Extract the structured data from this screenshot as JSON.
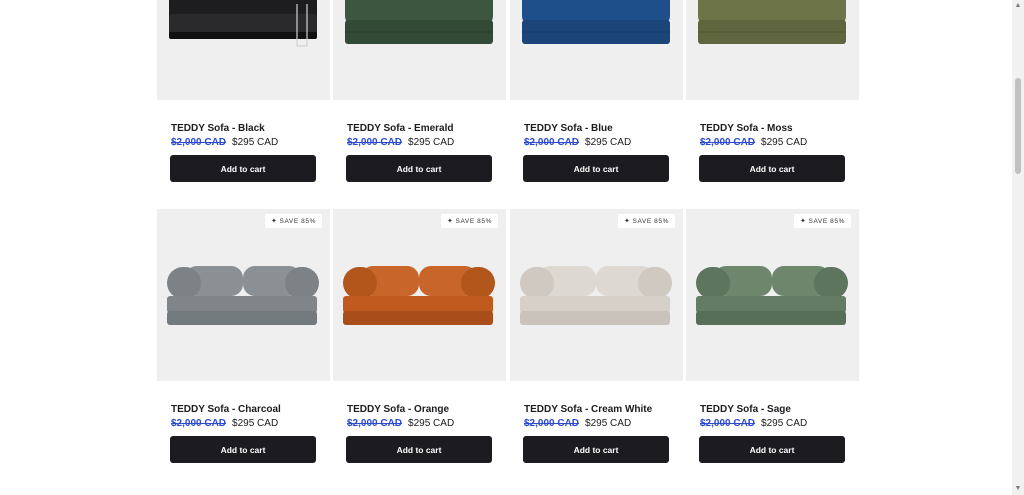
{
  "products": [
    {
      "title": "TEDDY Sofa - Black",
      "old_price": "$2,000 CAD",
      "price": "$295 CAD",
      "button": "Add to cart",
      "color": "#1d1d1f"
    },
    {
      "title": "TEDDY Sofa - Emerald",
      "old_price": "$2,000 CAD",
      "price": "$295 CAD",
      "button": "Add to cart",
      "color": "#3d5640"
    },
    {
      "title": "TEDDY Sofa - Blue",
      "old_price": "$2,000 CAD",
      "price": "$295 CAD",
      "button": "Add to cart",
      "color": "#1f4f8a"
    },
    {
      "title": "TEDDY Sofa - Moss",
      "old_price": "$2,000 CAD",
      "price": "$295 CAD",
      "button": "Add to cart",
      "color": "#6d7448"
    },
    {
      "title": "TEDDY Sofa - Charcoal",
      "old_price": "$2,000 CAD",
      "price": "$295 CAD",
      "button": "Add to cart",
      "badge": "SAVE 85%",
      "color": "#7f8588"
    },
    {
      "title": "TEDDY Sofa - Orange",
      "old_price": "$2,000 CAD",
      "price": "$295 CAD",
      "button": "Add to cart",
      "badge": "SAVE 85%",
      "color": "#c15a1f"
    },
    {
      "title": "TEDDY Sofa - Cream White",
      "old_price": "$2,000 CAD",
      "price": "$295 CAD",
      "button": "Add to cart",
      "badge": "SAVE 85%",
      "color": "#d6d0c8"
    },
    {
      "title": "TEDDY Sofa - Sage",
      "old_price": "$2,000 CAD",
      "price": "$295 CAD",
      "button": "Add to cart",
      "badge": "SAVE 85%",
      "color": "#647c63"
    }
  ],
  "colors": {
    "button_bg": "#1c1c20",
    "old_price": "#2e4bd0",
    "image_bg": "#efefef"
  },
  "icons": {
    "badge_icon": "sparkle-icon"
  }
}
